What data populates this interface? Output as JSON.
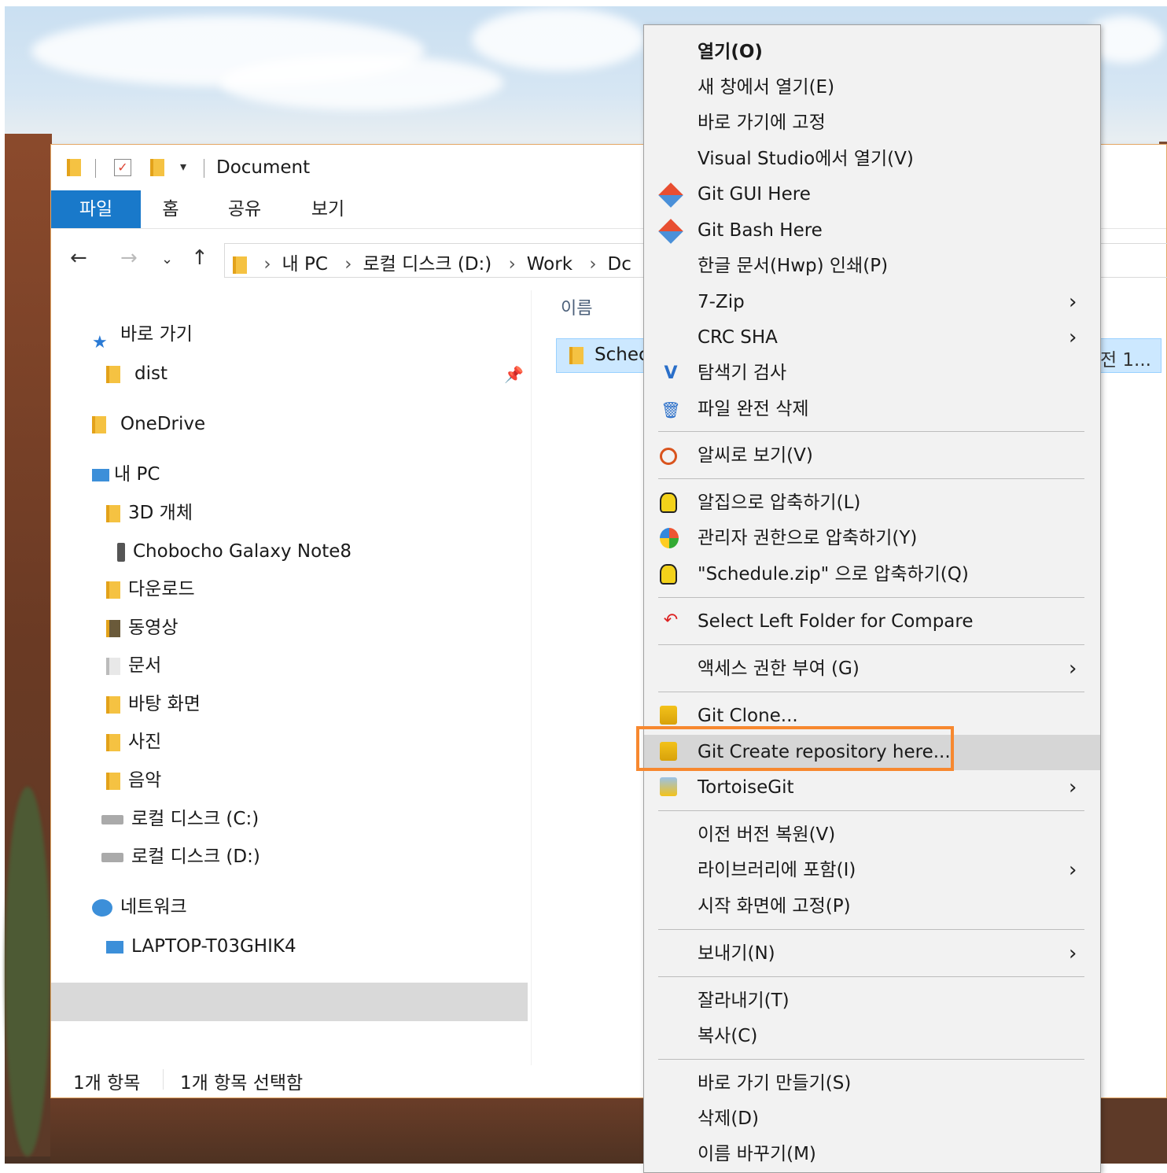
{
  "window": {
    "title": "Document",
    "tabs": [
      "파일",
      "홈",
      "공유",
      "보기"
    ]
  },
  "address": {
    "crumbs": [
      "내 PC",
      "로컬 디스크 (D:)",
      "Work",
      "Dc"
    ]
  },
  "navpane": {
    "quick_access": "바로 가기",
    "dist": "dist",
    "onedrive": "OneDrive",
    "this_pc": "내 PC",
    "objects3d": "3D 개체",
    "phone": "Chobocho Galaxy Note8",
    "downloads": "다운로드",
    "videos": "동영상",
    "documents": "문서",
    "desktop": "바탕 화면",
    "pictures": "사진",
    "music": "음악",
    "disk_c": "로컬 디스크 (C:)",
    "disk_d": "로컬 디스크 (D:)",
    "network": "네트워크",
    "laptop": "LAPTOP-T03GHIK4"
  },
  "content": {
    "col_name": "이름",
    "file_name": "Schec",
    "file_date": "전 1..."
  },
  "status": {
    "count": "1개 항목",
    "selected": "1개 항목 선택함"
  },
  "context_menu": {
    "open": "열기(O)",
    "open_new_window": "새 창에서 열기(E)",
    "pin_quick": "바로 가기에 고정",
    "open_vs": "Visual Studio에서 열기(V)",
    "git_gui": "Git GUI Here",
    "git_bash": "Git Bash Here",
    "hwp_print": "한글 문서(Hwp) 인쇄(P)",
    "zip7": "7-Zip",
    "crc": "CRC SHA",
    "scan": "탐색기 검사",
    "shred": "파일 완전 삭제",
    "alsee": "알씨로 보기(V)",
    "alzip_compress": "알집으로 압축하기(L)",
    "admin_compress": "관리자 권한으로 압축하기(Y)",
    "zip_named": "\"Schedule.zip\" 으로 압축하기(Q)",
    "compare": "Select Left Folder for Compare",
    "grant_access": "액세스 권한 부여 (G)",
    "git_clone": "Git Clone...",
    "git_create": "Git Create repository here...",
    "tortoise": "TortoiseGit",
    "restore": "이전 버전 복원(V)",
    "library": "라이브러리에 포함(I)",
    "pin_start": "시작 화면에 고정(P)",
    "send_to": "보내기(N)",
    "cut": "잘라내기(T)",
    "copy": "복사(C)",
    "shortcut": "바로 가기 만들기(S)",
    "delete": "삭제(D)",
    "rename": "이름 바꾸기(M)"
  }
}
